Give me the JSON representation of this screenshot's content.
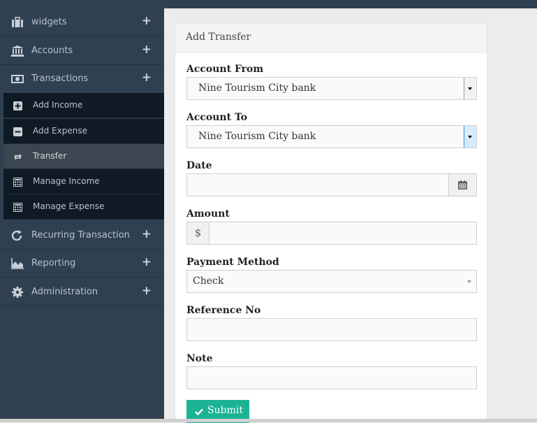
{
  "sidebar": {
    "items": [
      {
        "label": "widgets",
        "icon": "briefcase-icon"
      },
      {
        "label": "Accounts",
        "icon": "bank-icon"
      },
      {
        "label": "Transactions",
        "icon": "money-icon"
      }
    ],
    "transactions_sub": [
      {
        "label": "Add Income",
        "icon": "plus-square-icon"
      },
      {
        "label": "Add Expense",
        "icon": "minus-square-icon"
      },
      {
        "label": "Transfer",
        "icon": "retweet-icon",
        "active": true
      },
      {
        "label": "Manage Income",
        "icon": "calculator-icon"
      },
      {
        "label": "Manage Expense",
        "icon": "calculator-icon"
      }
    ],
    "items_after": [
      {
        "label": "Recurring Transaction",
        "icon": "refresh-icon"
      },
      {
        "label": "Reporting",
        "icon": "area-chart-icon"
      },
      {
        "label": "Administration",
        "icon": "gear-icon"
      }
    ],
    "expand_symbol": "+"
  },
  "panel": {
    "title": "Add Transfer"
  },
  "form": {
    "account_from": {
      "label": "Account From",
      "value": "Nine Tourism City bank"
    },
    "account_to": {
      "label": "Account To",
      "value": "Nine Tourism City bank"
    },
    "date": {
      "label": "Date",
      "value": ""
    },
    "amount": {
      "label": "Amount",
      "currency_symbol": "$",
      "value": ""
    },
    "payment_method": {
      "label": "Payment Method",
      "value": "Check"
    },
    "reference_no": {
      "label": "Reference No",
      "value": ""
    },
    "note": {
      "label": "Note",
      "value": ""
    },
    "submit_label": "Submit"
  },
  "colors": {
    "sidebar_bg": "#2f4050",
    "submenu_bg": "#0f1a24",
    "accent": "#1ab394"
  }
}
